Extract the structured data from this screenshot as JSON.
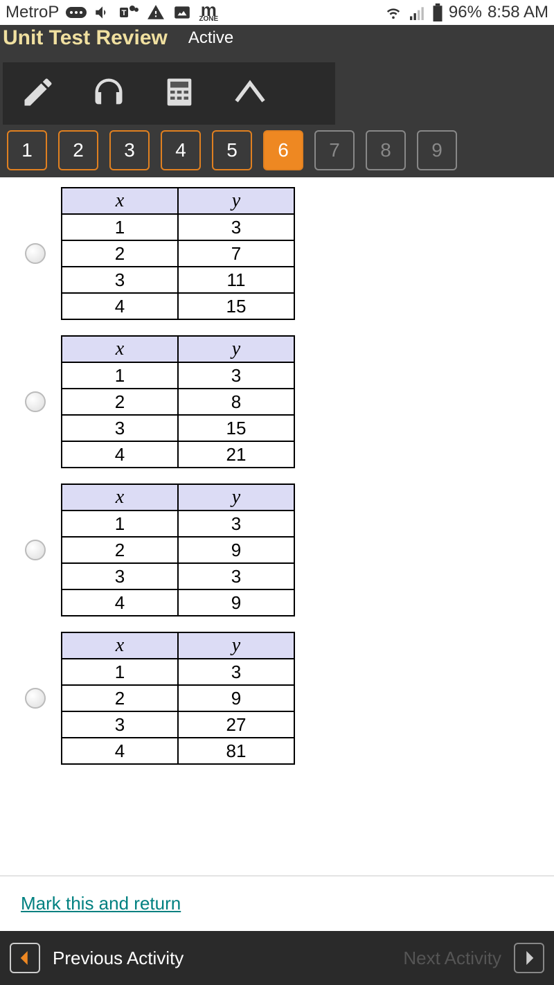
{
  "status_bar": {
    "carrier": "MetroP",
    "battery": "96%",
    "time": "8:58 AM",
    "zone_label": "ZONE"
  },
  "header": {
    "title": "Unit Test Review",
    "status": "Active"
  },
  "nav": {
    "items": [
      "1",
      "2",
      "3",
      "4",
      "5",
      "6",
      "7",
      "8",
      "9"
    ],
    "active_index": 5,
    "disabled_start": 6
  },
  "options": [
    {
      "headers": [
        "x",
        "y"
      ],
      "rows": [
        [
          "1",
          "3"
        ],
        [
          "2",
          "7"
        ],
        [
          "3",
          "11"
        ],
        [
          "4",
          "15"
        ]
      ]
    },
    {
      "headers": [
        "x",
        "y"
      ],
      "rows": [
        [
          "1",
          "3"
        ],
        [
          "2",
          "8"
        ],
        [
          "3",
          "15"
        ],
        [
          "4",
          "21"
        ]
      ]
    },
    {
      "headers": [
        "x",
        "y"
      ],
      "rows": [
        [
          "1",
          "3"
        ],
        [
          "2",
          "9"
        ],
        [
          "3",
          "3"
        ],
        [
          "4",
          "9"
        ]
      ]
    },
    {
      "headers": [
        "x",
        "y"
      ],
      "rows": [
        [
          "1",
          "3"
        ],
        [
          "2",
          "9"
        ],
        [
          "3",
          "27"
        ],
        [
          "4",
          "81"
        ]
      ]
    }
  ],
  "mark_link": "Mark this and return",
  "footer": {
    "previous": "Previous Activity",
    "next": "Next Activity"
  }
}
